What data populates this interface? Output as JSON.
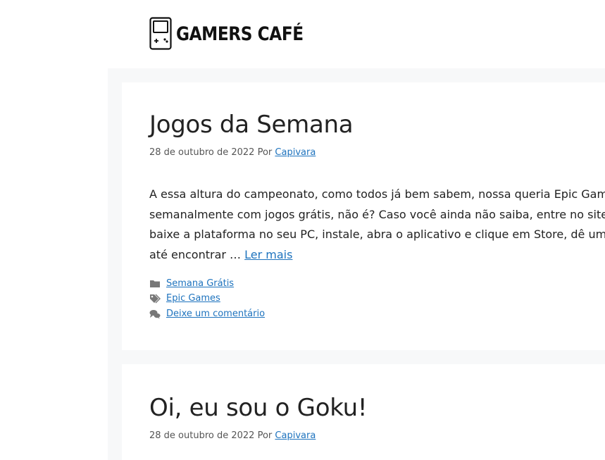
{
  "site": {
    "name": "GAMERS CAFÉ"
  },
  "posts": [
    {
      "title": "Jogos da Semana",
      "date": "28 de outubro de 2022",
      "by_label": "Por",
      "author": "Capivara",
      "excerpt_lines": [
        "A essa altura do campeonato, como todos já bem sabem, nossa queria Epic Games nos",
        "semanalmente com jogos grátis, não é? Caso você ainda não saiba, entre no site da Ep",
        "baixe a plataforma no seu PC, instale, abra o aplicativo e clique em Store, dê um scroll",
        "até encontrar …"
      ],
      "read_more": "Ler mais",
      "category": "Semana Grátis",
      "tag": "Epic Games",
      "comments": "Deixe um comentário"
    },
    {
      "title": "Oi, eu sou o Goku!",
      "date": "28 de outubro de 2022",
      "by_label": "Por",
      "author": "Capivara"
    }
  ],
  "icons": {
    "logo": "gameboy-icon",
    "category": "folder-icon",
    "tag": "tags-icon",
    "comments": "comments-icon"
  },
  "colors": {
    "link": "#1e73be",
    "background": "#f7f8f9",
    "card": "#ffffff",
    "text": "#222222",
    "icon": "#777777"
  }
}
